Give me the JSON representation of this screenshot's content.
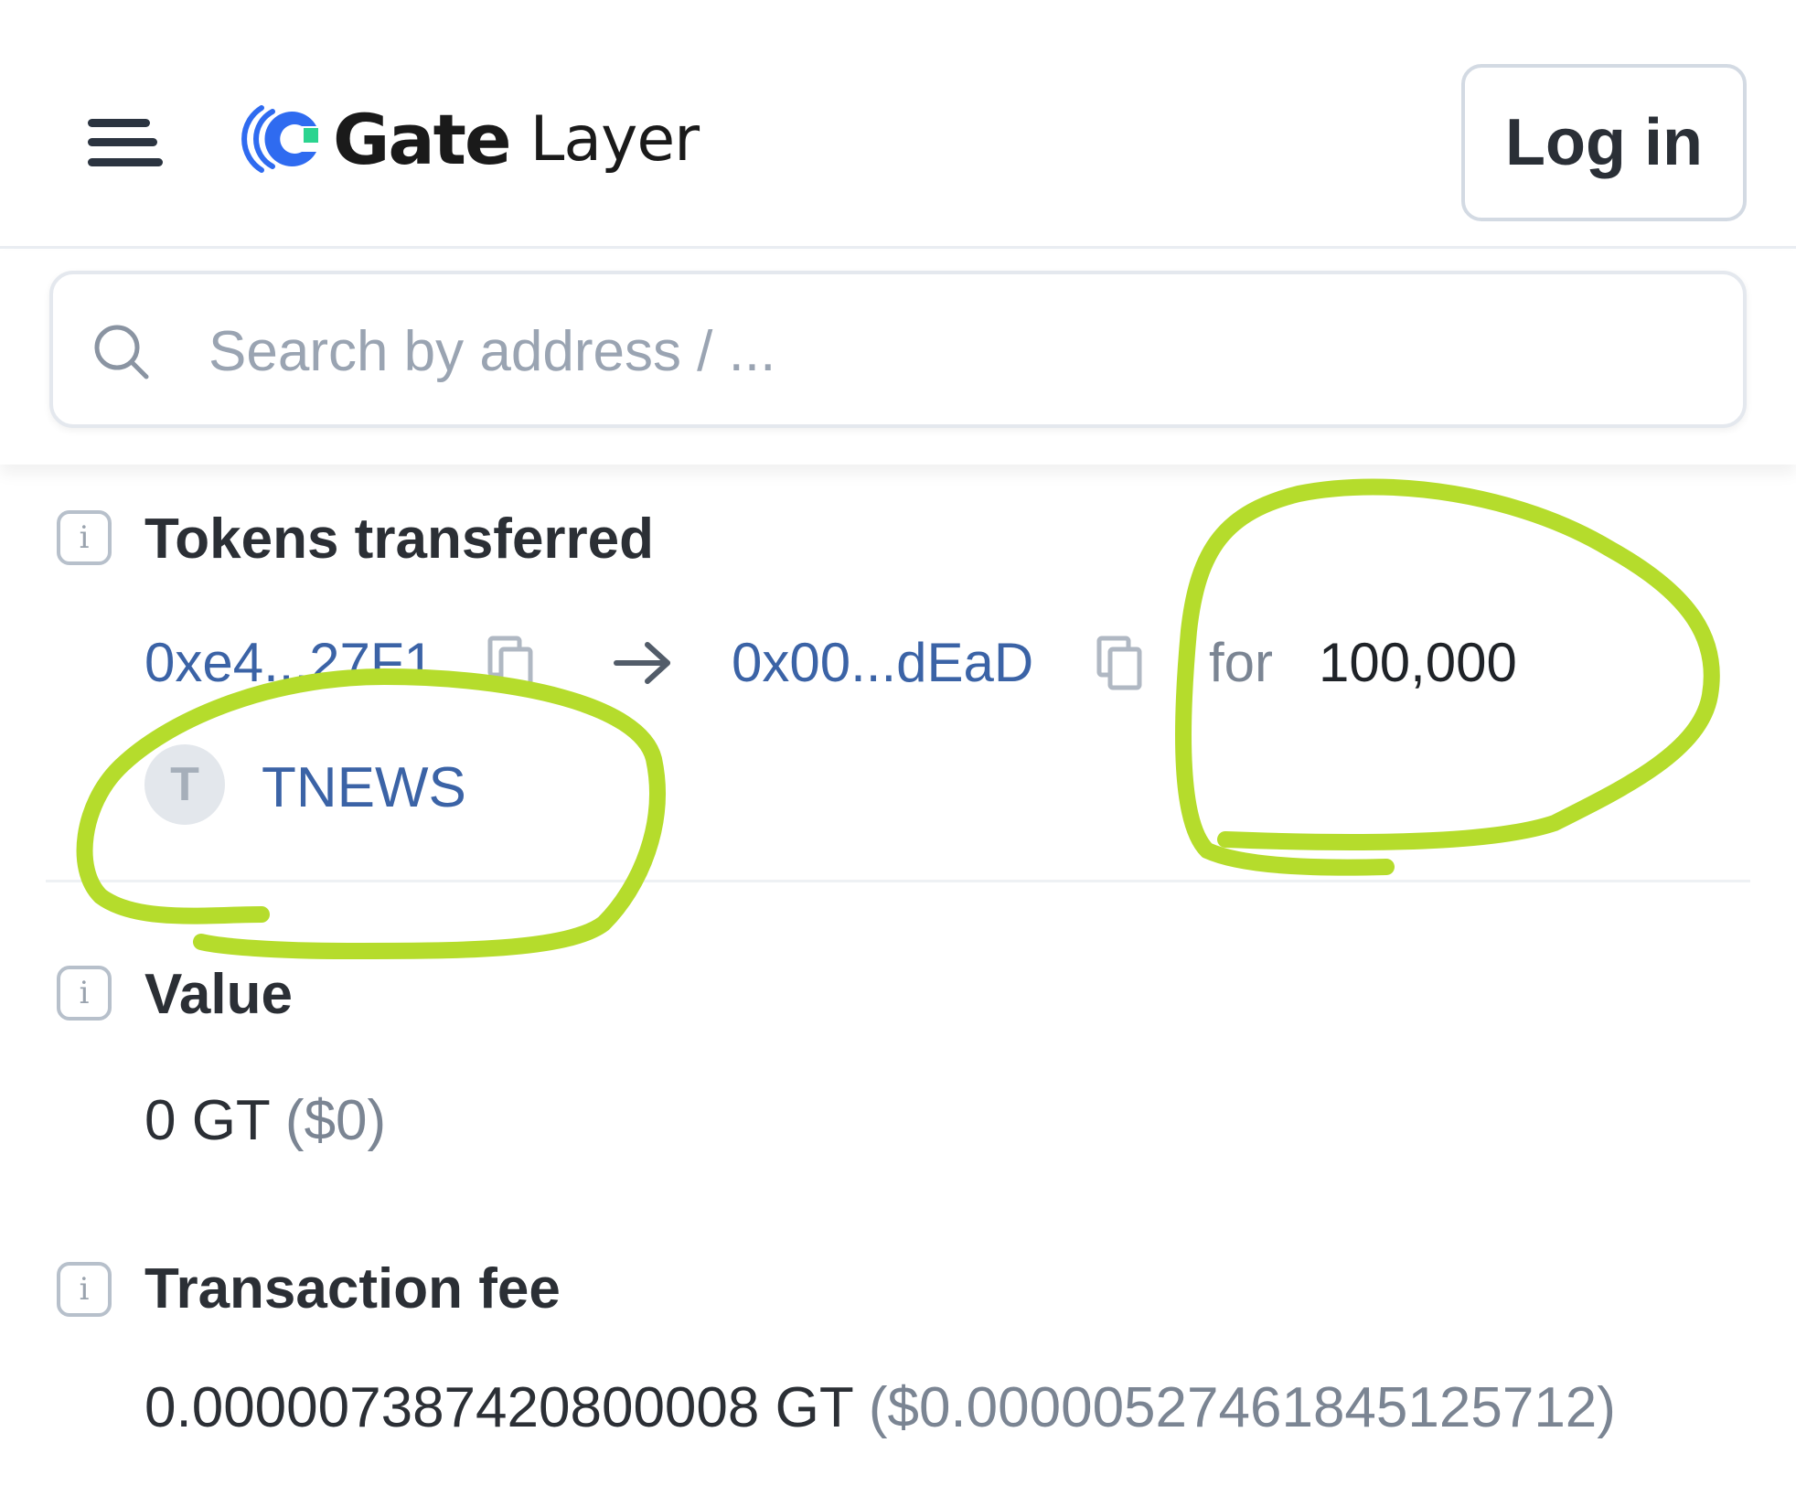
{
  "header": {
    "logo_brand": "Gate",
    "logo_sub": "Layer",
    "login_label": "Log in"
  },
  "search": {
    "placeholder": "Search by address / ..."
  },
  "tokens_transferred": {
    "title": "Tokens transferred",
    "from_address": "0xe4...27F1",
    "to_address": "0x00...dEaD",
    "for_label": "for",
    "amount": "100,000",
    "token_initial": "T",
    "token_name": "TNEWS"
  },
  "value": {
    "title": "Value",
    "amount": "0 GT",
    "usd": "($0)"
  },
  "transaction_fee": {
    "title": "Transaction fee",
    "amount": "0.000007387420800008 GT",
    "usd": "($0.0000052746184512571­2)"
  },
  "colors": {
    "brand_blue": "#2f6bf0",
    "brand_green": "#2bd48f",
    "link_blue": "#3b63a6",
    "annotation_green": "#b5dc2c"
  }
}
